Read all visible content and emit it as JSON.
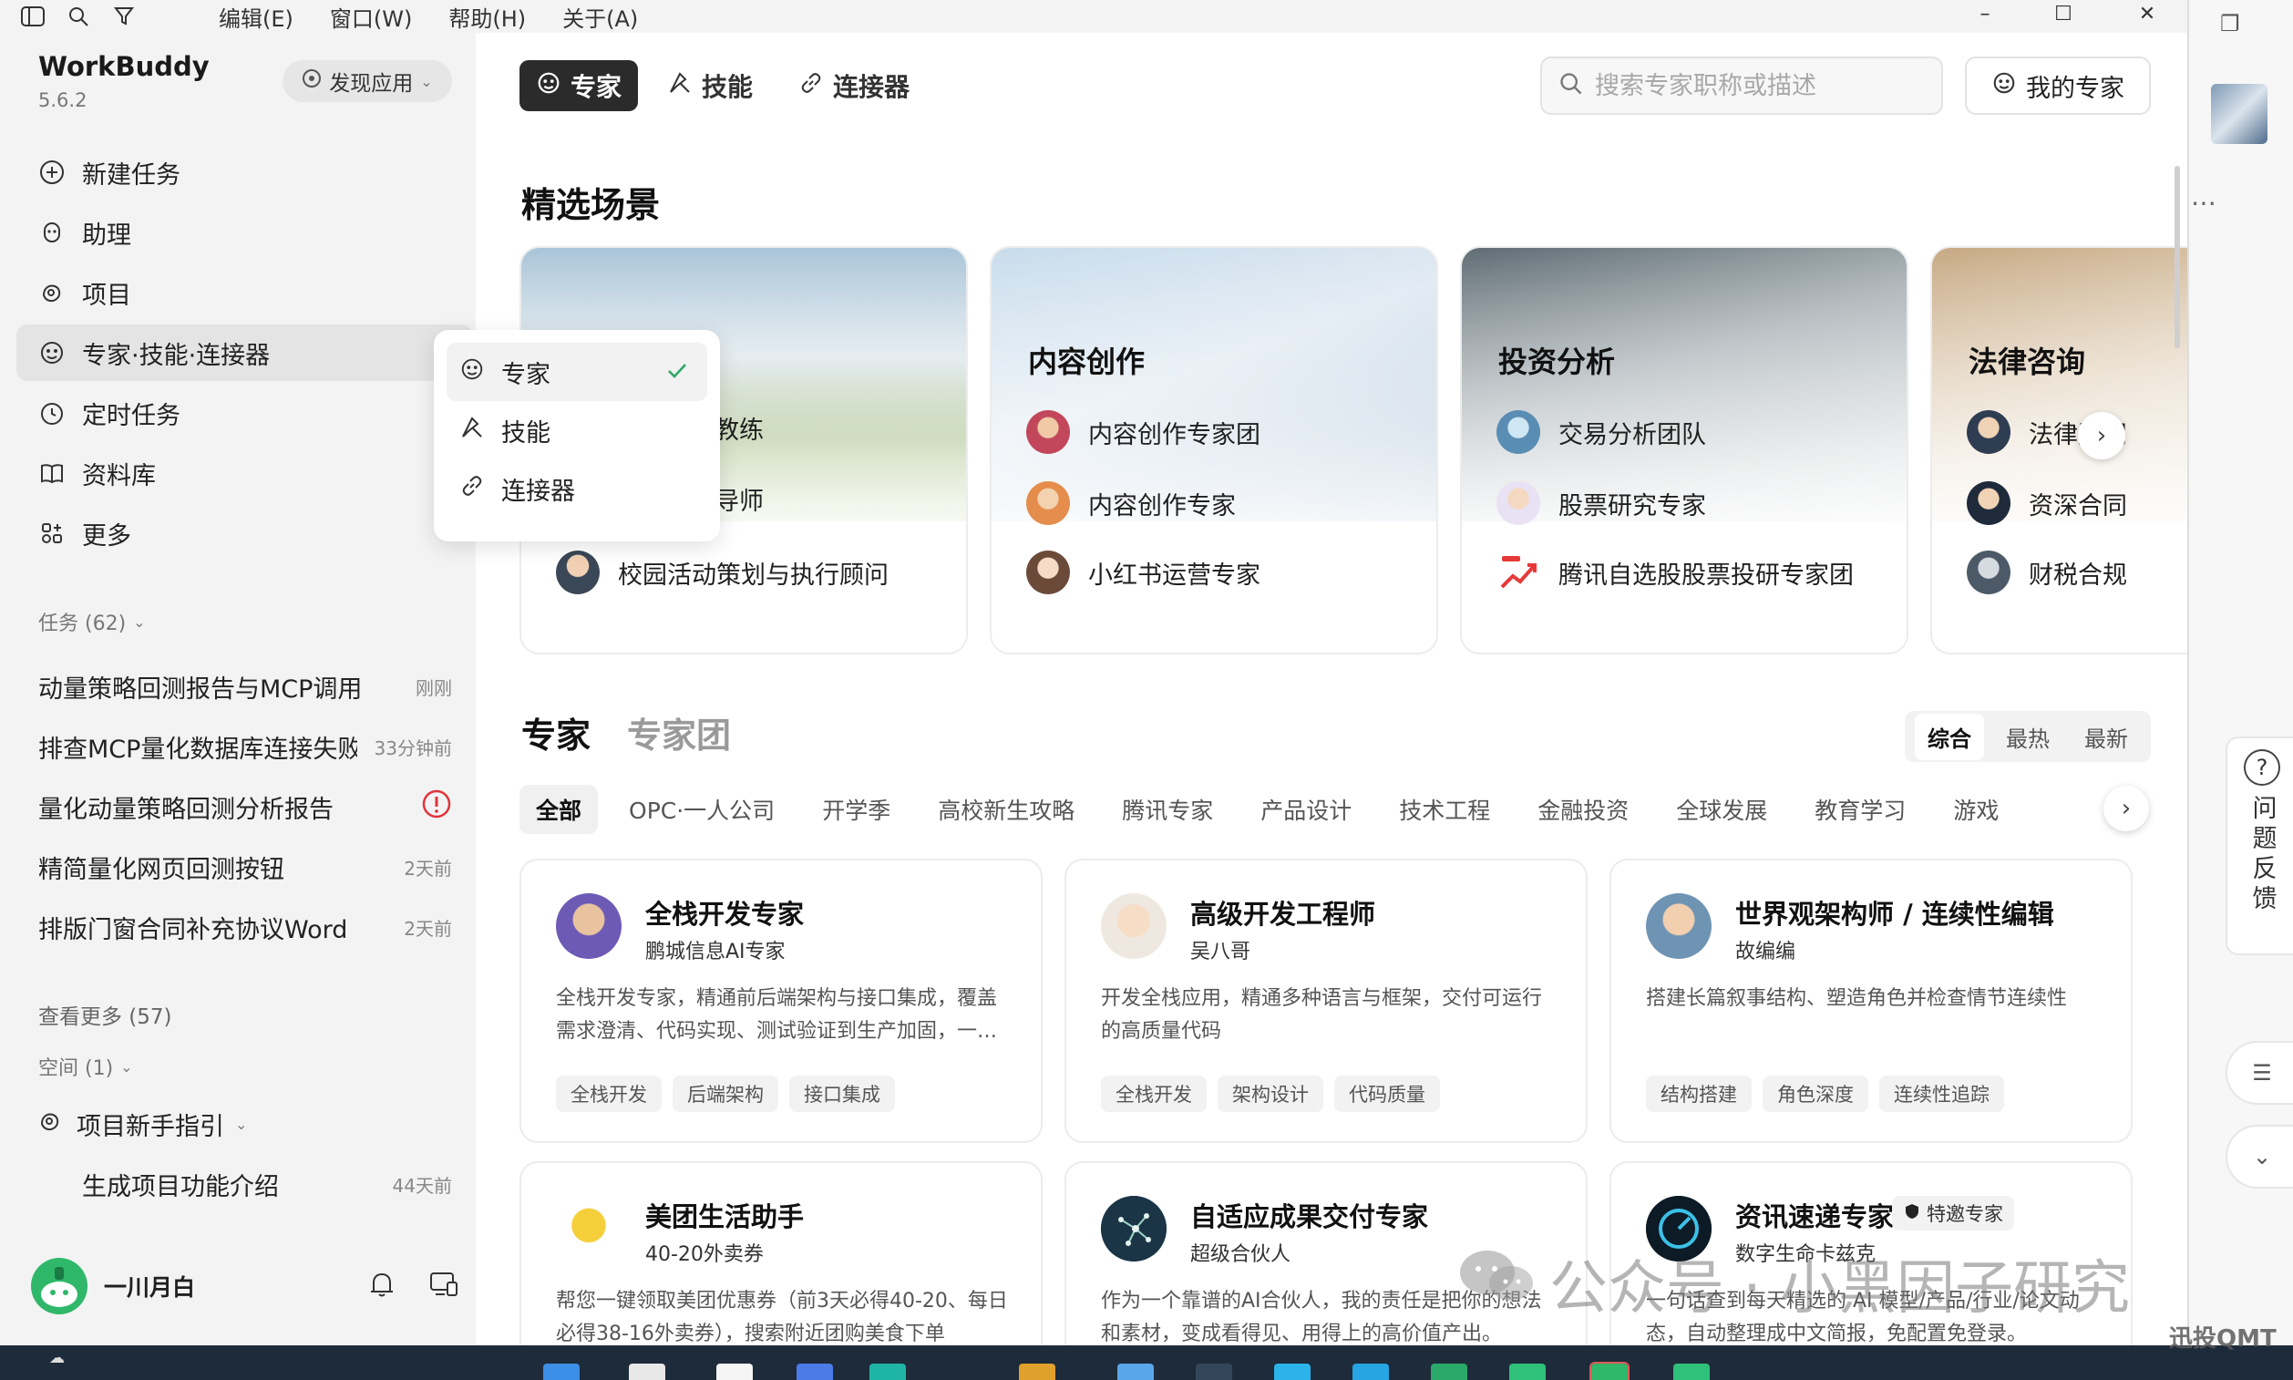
{
  "menubar": {
    "menus": [
      "编辑(E)",
      "窗口(W)",
      "帮助(H)",
      "关于(A)"
    ]
  },
  "app": {
    "name": "WorkBuddy",
    "version": "5.6.2",
    "discover_label": "发现应用"
  },
  "nav": [
    {
      "label": "新建任务",
      "icon": "plus-circle-icon"
    },
    {
      "label": "助理",
      "icon": "assistant-icon"
    },
    {
      "label": "项目",
      "icon": "project-icon"
    },
    {
      "label": "专家·技能·连接器",
      "icon": "expert-icon",
      "active": true
    },
    {
      "label": "定时任务",
      "icon": "clock-icon"
    },
    {
      "label": "资料库",
      "icon": "book-icon"
    },
    {
      "label": "更多",
      "icon": "grid-icon"
    }
  ],
  "tasks": {
    "header": "任务 (62)",
    "items": [
      {
        "title": "动量策略回测报告与MCP调用",
        "time": "刚刚"
      },
      {
        "title": "排查MCP量化数据库连接失败",
        "time": "33分钟前"
      },
      {
        "title": "量化动量策略回测分析报告",
        "time": "",
        "alert": true
      },
      {
        "title": "精简量化网页回测按钮",
        "time": "2天前"
      },
      {
        "title": "排版门窗合同补充协议Word",
        "time": "2天前"
      }
    ],
    "see_more": "查看更多 (57)"
  },
  "spaces": {
    "header": "空间 (1)",
    "group": "项目新手指引",
    "item": {
      "title": "生成项目功能介绍",
      "time": "44天前"
    }
  },
  "user": {
    "name": "一川月白"
  },
  "dropdown": {
    "items": [
      {
        "label": "专家",
        "selected": true
      },
      {
        "label": "技能"
      },
      {
        "label": "连接器"
      }
    ]
  },
  "main": {
    "tabs": [
      {
        "label": "专家",
        "active": true
      },
      {
        "label": "技能"
      },
      {
        "label": "连接器"
      }
    ],
    "search_placeholder": "搜索专家职称或描述",
    "my_experts_label": "我的专家",
    "featured_title": "精选场景",
    "scenes": [
      {
        "title": "",
        "rows": [
          "教练",
          "导师",
          "校园活动策划与执行顾问"
        ]
      },
      {
        "title": "内容创作",
        "rows": [
          "内容创作专家团",
          "内容创作专家",
          "小红书运营专家"
        ]
      },
      {
        "title": "投资分析",
        "rows": [
          "交易分析团队",
          "股票研究专家",
          "腾讯自选股股票投研专家团"
        ]
      },
      {
        "title": "法律咨询",
        "rows": [
          "法律顾问",
          "资深合同",
          "财税合规"
        ]
      }
    ],
    "expert_tab_on": "专家",
    "expert_tab_off": "专家团",
    "sort": [
      "综合",
      "最热",
      "最新"
    ],
    "categories": [
      "全部",
      "OPC·一人公司",
      "开学季",
      "高校新生攻略",
      "腾讯专家",
      "产品设计",
      "技术工程",
      "金融投资",
      "全球发展",
      "教育学习",
      "游戏"
    ],
    "cards": [
      {
        "name": "全栈开发专家",
        "sub": "鹏城信息AI专家",
        "desc": "全栈开发专家，精通前后端架构与接口集成，覆盖需求澄清、代码实现、测试验证到生产加固，一…",
        "tags": [
          "全栈开发",
          "后端架构",
          "接口集成"
        ]
      },
      {
        "name": "高级开发工程师",
        "sub": "吴八哥",
        "desc": "开发全栈应用，精通多种语言与框架，交付可运行的高质量代码",
        "tags": [
          "全栈开发",
          "架构设计",
          "代码质量"
        ]
      },
      {
        "name": "世界观架构师 / 连续性编辑",
        "sub": "故编编",
        "desc": "搭建长篇叙事结构、塑造角色并检查情节连续性",
        "tags": [
          "结构搭建",
          "角色深度",
          "连续性追踪"
        ]
      },
      {
        "name": "美团生活助手",
        "sub": "40-20外卖券",
        "desc": "帮您一键领取美团优惠券（前3天必得40-20、每日必得38-16外卖券），搜索附近团购美食下单",
        "tags": []
      },
      {
        "name": "自适应成果交付专家",
        "sub": "超级合伙人",
        "desc": "作为一个靠谱的AI合伙人，我的责任是把你的想法和素材，变成看得见、用得上的高价值产出。",
        "tags": []
      },
      {
        "name": "资讯速递专家",
        "sub": "数字生命卡兹克",
        "badge": "特邀专家",
        "desc": "一句话查到每天精选的 AI 模型/产品/行业/论文动态，自动整理成中文简报，免配置免登录。",
        "tags": []
      }
    ]
  },
  "right_panel": {
    "feedback_label": "问题反馈"
  },
  "watermark": {
    "text": "公众号 · 小黑因子研究",
    "corner": "迅投QMT"
  }
}
